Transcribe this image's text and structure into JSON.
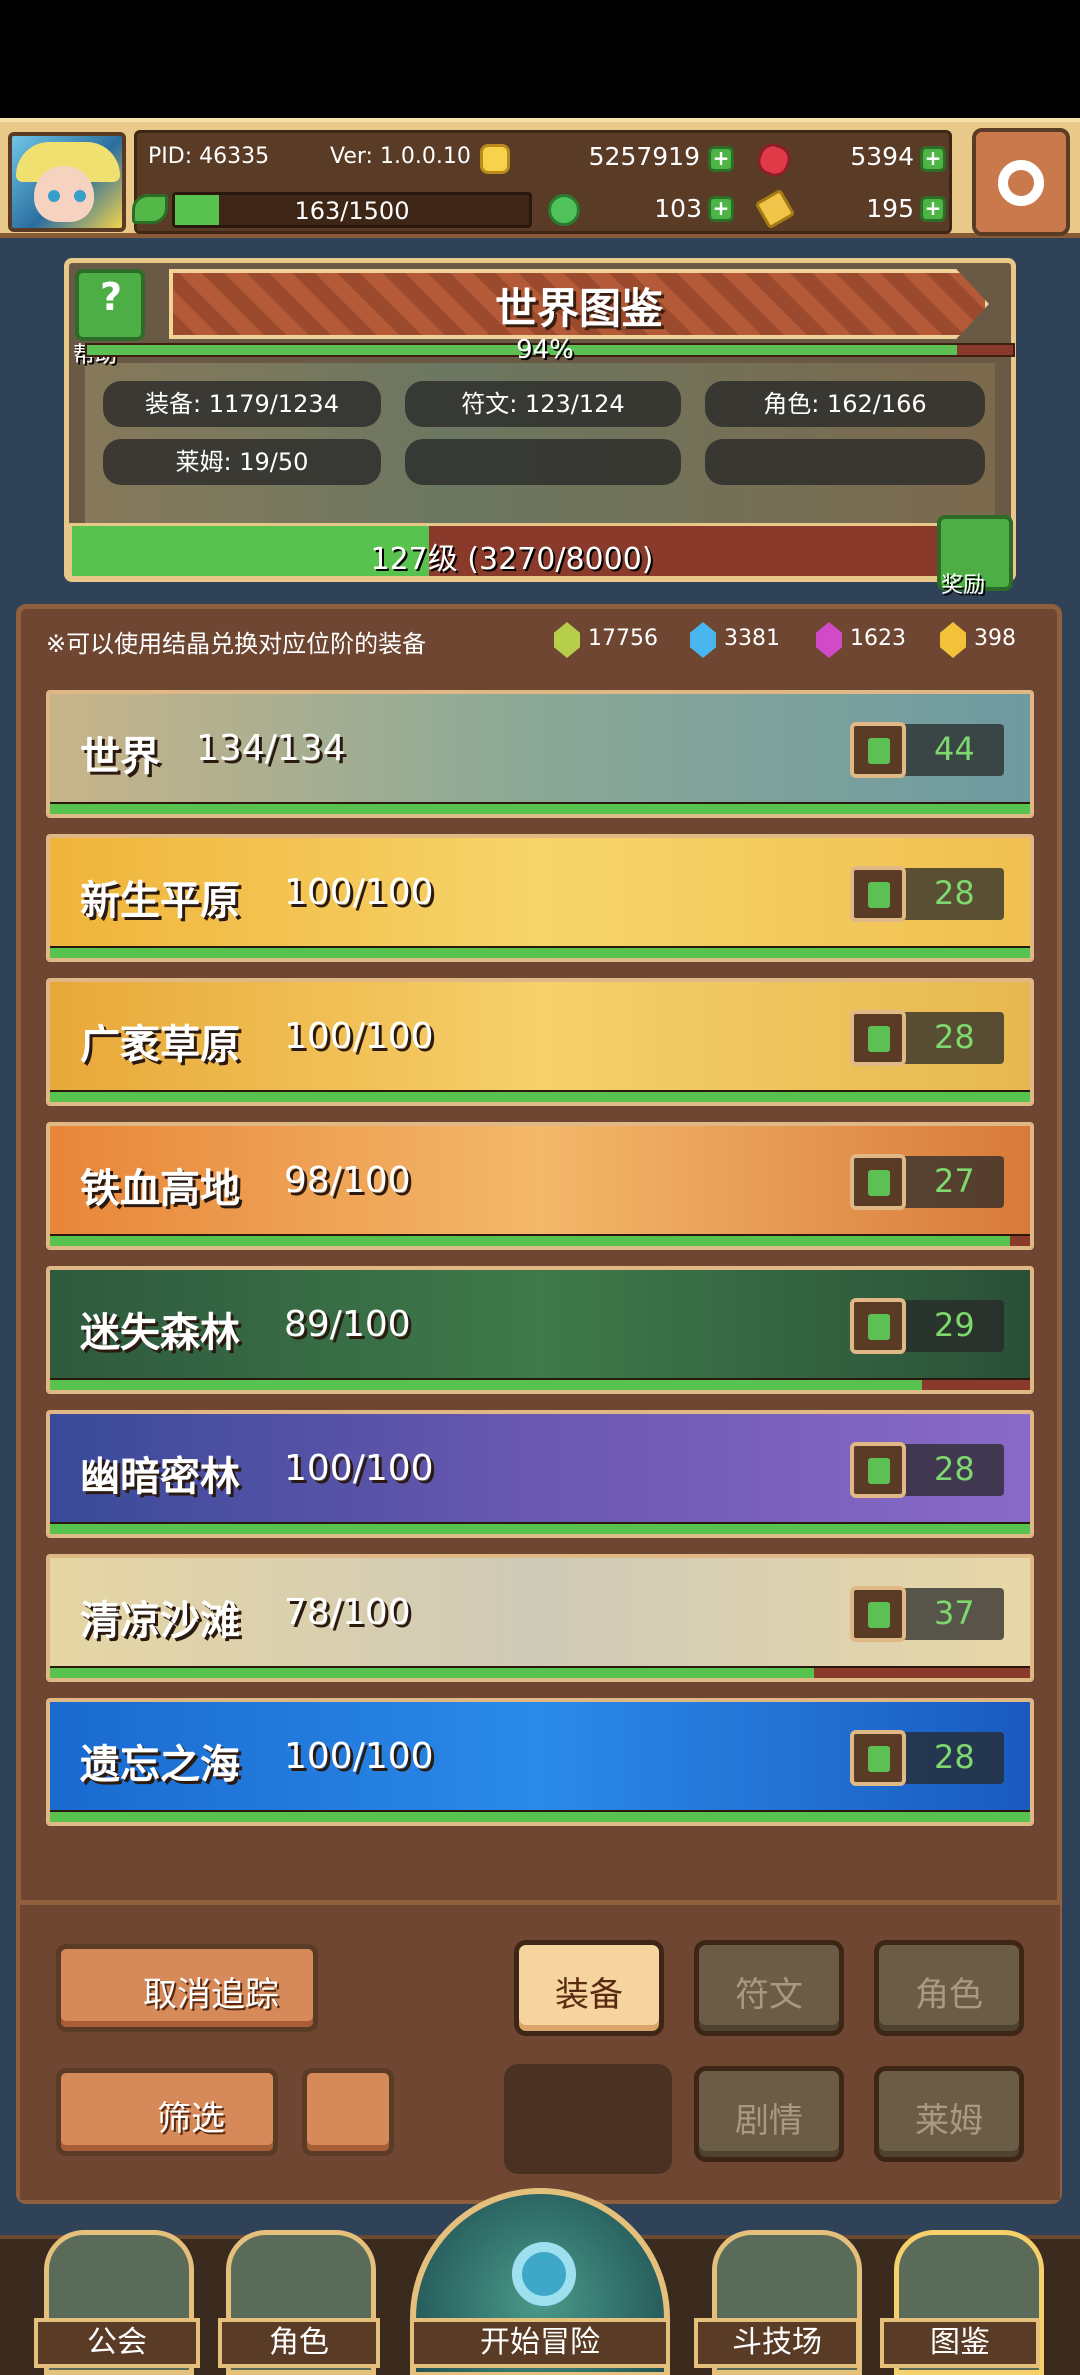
{
  "header": {
    "pid": "PID: 46335",
    "version": "Ver: 1.0.0.10",
    "gold": "5257919",
    "gems": "5394",
    "stamina": "163/1500",
    "clover": "103",
    "keys": "195"
  },
  "codex": {
    "help_label": "帮助",
    "title": "世界图鉴",
    "percent": "94%",
    "percent_value": 0.94,
    "stats": [
      "装备: 1179/1234",
      "符文: 123/124",
      "角色: 162/166",
      "莱姆: 19/50"
    ],
    "level": "127级 (3270/8000)",
    "level_progress": 0.409,
    "reward_label": "奖励"
  },
  "info": {
    "note": "※可以使用结晶兑换对应位阶的装备",
    "crystals": [
      {
        "color": "#b6cf4a",
        "value": "17756"
      },
      {
        "color": "#4ab6f0",
        "value": "3381"
      },
      {
        "color": "#d24ac8",
        "value": "1623"
      },
      {
        "color": "#f2c23a",
        "value": "398"
      }
    ]
  },
  "regions": [
    {
      "name": "世界",
      "count": "134/134",
      "likes": "44",
      "progress": 1.0,
      "bg": "linear-gradient(90deg,#c9b48a,#8eaa96 45%,#6e9aa0)"
    },
    {
      "name": "新生平原",
      "count": "100/100",
      "likes": "28",
      "progress": 1.0,
      "bg": "linear-gradient(90deg,#f0b43a,#f6d46a 50%,#f0c050)"
    },
    {
      "name": "广袤草原",
      "count": "100/100",
      "likes": "28",
      "progress": 1.0,
      "bg": "linear-gradient(90deg,#e8a838,#f6d06a 50%,#e6b850)"
    },
    {
      "name": "铁血高地",
      "count": "98/100",
      "likes": "27",
      "progress": 0.98,
      "bg": "linear-gradient(90deg,#e8863a,#f4b86a 50%,#d87a3a)"
    },
    {
      "name": "迷失森林",
      "count": "89/100",
      "likes": "29",
      "progress": 0.89,
      "bg": "linear-gradient(90deg,#2e5a3e,#3f7a4a 50%,#2a5038)"
    },
    {
      "name": "幽暗密林",
      "count": "100/100",
      "likes": "28",
      "progress": 1.0,
      "bg": "linear-gradient(90deg,#3a4a9a,#6a58b0 50%,#8a6ac8)"
    },
    {
      "name": "清凉沙滩",
      "count": "78/100",
      "likes": "37",
      "progress": 0.78,
      "bg": "linear-gradient(90deg,#e6d6a4,#cfcab8 50%,#e8d8a8)"
    },
    {
      "name": "遗忘之海",
      "count": "100/100",
      "likes": "28",
      "progress": 1.0,
      "bg": "linear-gradient(90deg,#1a6ad0,#2a8ae8 50%,#1a5ac0)"
    }
  ],
  "controls": {
    "untrack": "取消追踪",
    "filter": "筛选",
    "tabs": [
      "装备",
      "符文",
      "角色",
      "剧情",
      "莱姆"
    ]
  },
  "nav": {
    "guild": "公会",
    "character": "角色",
    "adventure": "开始冒险",
    "arena": "斗技场",
    "codex": "图鉴"
  }
}
